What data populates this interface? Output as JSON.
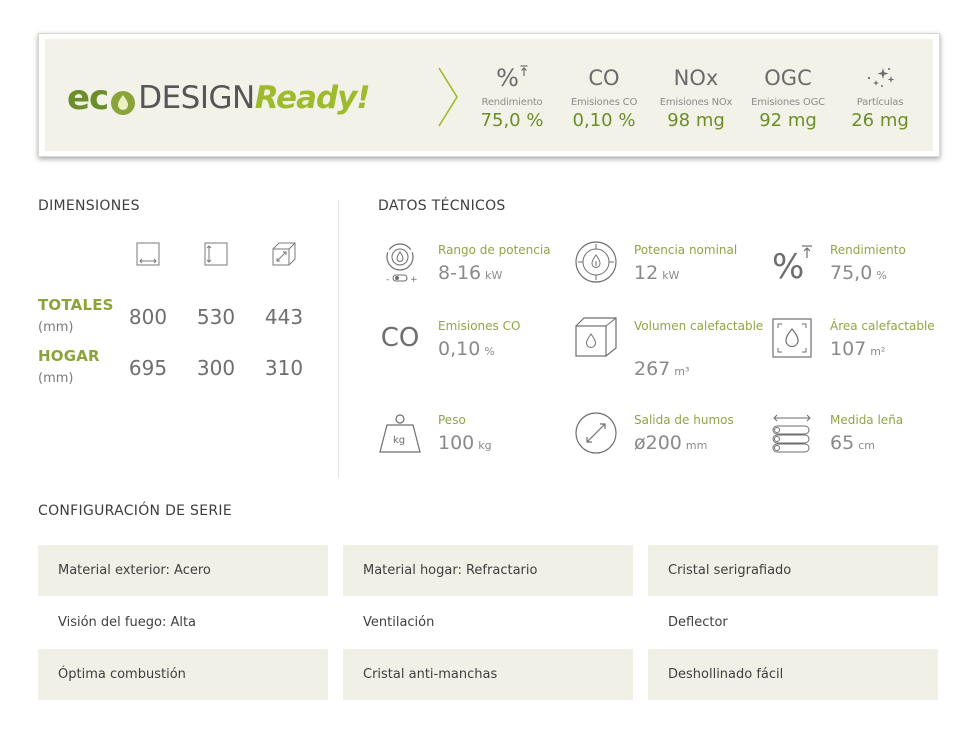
{
  "ecodesign": {
    "logo": {
      "eco": "ec",
      "design": "DESIGN",
      "ready": "Ready!"
    },
    "metrics": [
      {
        "symbol": "%",
        "label": "Rendimiento",
        "value": "75,0 %"
      },
      {
        "symbol": "CO",
        "label": "Emisiones CO",
        "value": "0,10 %"
      },
      {
        "symbol": "NOx",
        "label": "Emisiones NOx",
        "value": "98 mg"
      },
      {
        "symbol": "OGC",
        "label": "Emisiones OGC",
        "value": "92 mg"
      },
      {
        "symbol": "",
        "label": "Partículas",
        "value": "26 mg"
      }
    ]
  },
  "dimensiones": {
    "title": "DIMENSIONES",
    "icons": [
      "width-icon",
      "height-icon",
      "depth-icon"
    ],
    "rows": [
      {
        "label": "TOTALES",
        "unit": "(mm)",
        "values": [
          "800",
          "530",
          "443"
        ]
      },
      {
        "label": "HOGAR",
        "unit": "(mm)",
        "values": [
          "695",
          "300",
          "310"
        ]
      }
    ]
  },
  "datos_tecnicos": {
    "title": "DATOS TÉCNICOS",
    "items": [
      {
        "icon": "power-range-icon",
        "label": "Rango de potencia",
        "value": "8-16",
        "unit": "kW"
      },
      {
        "icon": "nominal-power-icon",
        "label": "Potencia nominal",
        "value": "12",
        "unit": "kW"
      },
      {
        "icon": "efficiency-icon",
        "label": "Rendimiento",
        "value": "75,0",
        "unit": "%"
      },
      {
        "icon": "co-emissions-icon",
        "label": "Emisiones CO",
        "value": "0,10",
        "unit": "%"
      },
      {
        "icon": "heated-volume-icon",
        "label": "Volumen calefactable",
        "value": "267",
        "unit": "m³"
      },
      {
        "icon": "heated-area-icon",
        "label": "Área calefactable",
        "value": "107",
        "unit": "m²"
      },
      {
        "icon": "weight-icon",
        "label": "Peso",
        "value": "100",
        "unit": "kg"
      },
      {
        "icon": "flue-outlet-icon",
        "label": "Salida de humos",
        "value": "ø200",
        "unit": "mm"
      },
      {
        "icon": "log-size-icon",
        "label": "Medida leña",
        "value": "65",
        "unit": "cm"
      }
    ],
    "co_symbol": "CO",
    "weight_symbol": "kg"
  },
  "configuracion": {
    "title": "CONFIGURACIÓN DE SERIE",
    "rows": [
      [
        "Material exterior: Acero",
        "Material hogar: Refractario",
        "Cristal serigrafiado"
      ],
      [
        "Visión del fuego: Alta",
        "Ventilación",
        "Deflector"
      ],
      [
        "Óptima combustión",
        "Cristal anti-manchas",
        "Deshollinado fácil"
      ]
    ]
  },
  "colors": {
    "accent_green": "#8aa43a",
    "dark_green": "#6b8e2a",
    "light_green": "#9dbb2c",
    "panel_bg": "#f2f2e8",
    "cell_bg": "#f0f0e6"
  }
}
